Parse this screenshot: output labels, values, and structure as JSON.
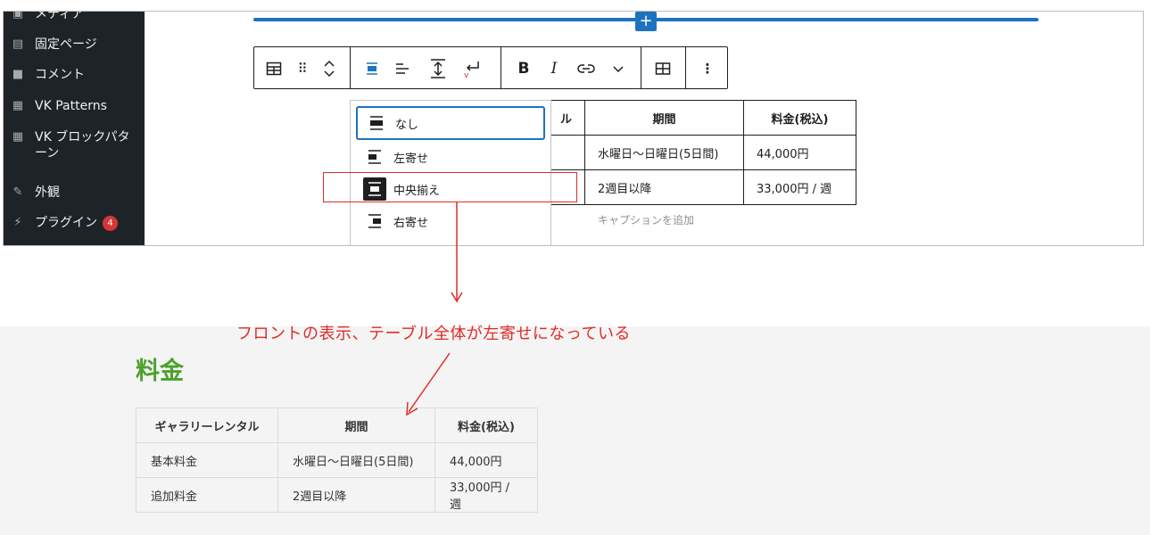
{
  "sidebar": {
    "items": [
      {
        "label": "メディア",
        "icon": "media-icon"
      },
      {
        "label": "固定ページ",
        "icon": "pages-icon"
      },
      {
        "label": "コメント",
        "icon": "comments-icon"
      },
      {
        "label": "VK Patterns",
        "icon": "grid-icon"
      },
      {
        "label": "VK ブロックパターン",
        "icon": "grid-icon"
      },
      {
        "label": "外観",
        "icon": "paintbrush-icon"
      },
      {
        "label": "プラグイン",
        "icon": "plugin-icon",
        "badge": "4"
      }
    ]
  },
  "toolbar": {
    "buttons": [
      "table-icon",
      "drag-handle-icon",
      "move-up-down-icon",
      "align-center-icon",
      "align-left-icon",
      "vertical-align-icon",
      "text-wrap-icon",
      "bold-icon",
      "italic-icon",
      "link-icon",
      "chevron-down-icon",
      "edit-table-icon",
      "more-options-icon"
    ],
    "bold_glyph": "B",
    "italic_glyph": "I"
  },
  "alignment_menu": {
    "options": [
      {
        "label": "なし",
        "state": "focused"
      },
      {
        "label": "左寄せ",
        "state": ""
      },
      {
        "label": "中央揃え",
        "state": "selected"
      },
      {
        "label": "右寄せ",
        "state": ""
      }
    ]
  },
  "editor_table": {
    "header_partial": "ル",
    "headers": [
      "期間",
      "料金(税込)"
    ],
    "rows": [
      [
        "水曜日〜日曜日(5日間)",
        "44,000円"
      ],
      [
        "2週目以降",
        "33,000円 / 週"
      ]
    ],
    "caption_placeholder": "キャプションを追加"
  },
  "annotation": "フロントの表示、テーブル全体が左寄せになっている",
  "front": {
    "heading": "料金",
    "headers": [
      "ギャラリーレンタル",
      "期間",
      "料金(税込)"
    ],
    "rows": [
      [
        "基本料金",
        "水曜日〜日曜日(5日間)",
        "44,000円"
      ],
      [
        "追加料金",
        "2週目以降",
        "33,000円 / 週"
      ]
    ]
  },
  "colors": {
    "accent": "#1e73be",
    "annotation_red": "#e02b27",
    "heading_green": "#4ca12b",
    "sidebar_bg": "#1e2327"
  }
}
